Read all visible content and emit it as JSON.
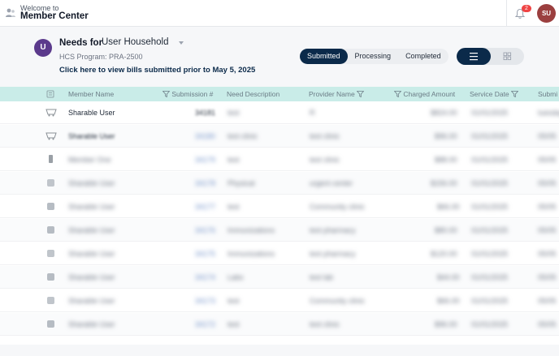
{
  "topbar": {
    "welcome": "Welcome to",
    "title": "Member Center",
    "notification_count": "2",
    "user_initials": "SU"
  },
  "header": {
    "household_initial": "U",
    "needs_for_label": "Needs for",
    "household_name": "User Household",
    "program": "HCS Program: PRA-2500",
    "bills_link": "Click here to view bills submitted prior to May 5, 2025",
    "status_tabs": [
      {
        "label": "Submitted",
        "active": true
      },
      {
        "label": "Processing",
        "active": false
      },
      {
        "label": "Completed",
        "active": false
      }
    ]
  },
  "table": {
    "columns": {
      "member_name": "Member Name",
      "submission": "Submission #",
      "need_description": "Need Description",
      "provider_name": "Provider Name",
      "charged_amount": "Charged Amount",
      "service_date": "Service Date",
      "submitted": "Submi"
    },
    "rows": [
      {
        "member": "Sharable User",
        "submission": "34181",
        "need": "test",
        "provider": "R",
        "amount": "$824.00",
        "date": "01/01/2025",
        "submitted": "tuesday"
      },
      {
        "member": "Sharable User",
        "submission": "34180",
        "need": "test clinic",
        "provider": "test clinic",
        "amount": "$96.00",
        "date": "01/01/2025",
        "submitted": "05/05"
      },
      {
        "member": "Member One",
        "submission": "34179",
        "need": "test",
        "provider": "test clinic",
        "amount": "$88.00",
        "date": "01/01/2025",
        "submitted": "05/05"
      },
      {
        "member": "Sharable User",
        "submission": "34178",
        "need": "Physical",
        "provider": "urgent center",
        "amount": "$156.00",
        "date": "01/01/2025",
        "submitted": "05/05"
      },
      {
        "member": "Sharable User",
        "submission": "34177",
        "need": "test",
        "provider": "Community clinic",
        "amount": "$66.00",
        "date": "01/01/2025",
        "submitted": "05/05"
      },
      {
        "member": "Sharable User",
        "submission": "34176",
        "need": "Immunizations",
        "provider": "test pharmacy",
        "amount": "$80.00",
        "date": "01/01/2025",
        "submitted": "05/05"
      },
      {
        "member": "Sharable User",
        "submission": "34175",
        "need": "Immunizations",
        "provider": "test pharmacy",
        "amount": "$120.00",
        "date": "01/01/2025",
        "submitted": "05/05"
      },
      {
        "member": "Sharable User",
        "submission": "34174",
        "need": "Labs",
        "provider": "test lab",
        "amount": "$44.00",
        "date": "01/01/2025",
        "submitted": "05/05"
      },
      {
        "member": "Sharable User",
        "submission": "34173",
        "need": "test",
        "provider": "Community clinic",
        "amount": "$66.00",
        "date": "01/01/2025",
        "submitted": "05/05"
      },
      {
        "member": "Sharable User",
        "submission": "34172",
        "need": "test",
        "provider": "test clinic",
        "amount": "$96.00",
        "date": "01/01/2025",
        "submitted": "05/05"
      }
    ]
  },
  "colors": {
    "primary": "#0b2a4a",
    "header_row": "#c9ece8",
    "household_avatar": "#5b3a8c",
    "user_avatar": "#9b3f3f",
    "badge": "#ef4444"
  },
  "icons": [
    "member-center-icon",
    "bell-icon",
    "list-view-icon",
    "grid-view-icon",
    "filter-icon",
    "member-type-icon"
  ]
}
